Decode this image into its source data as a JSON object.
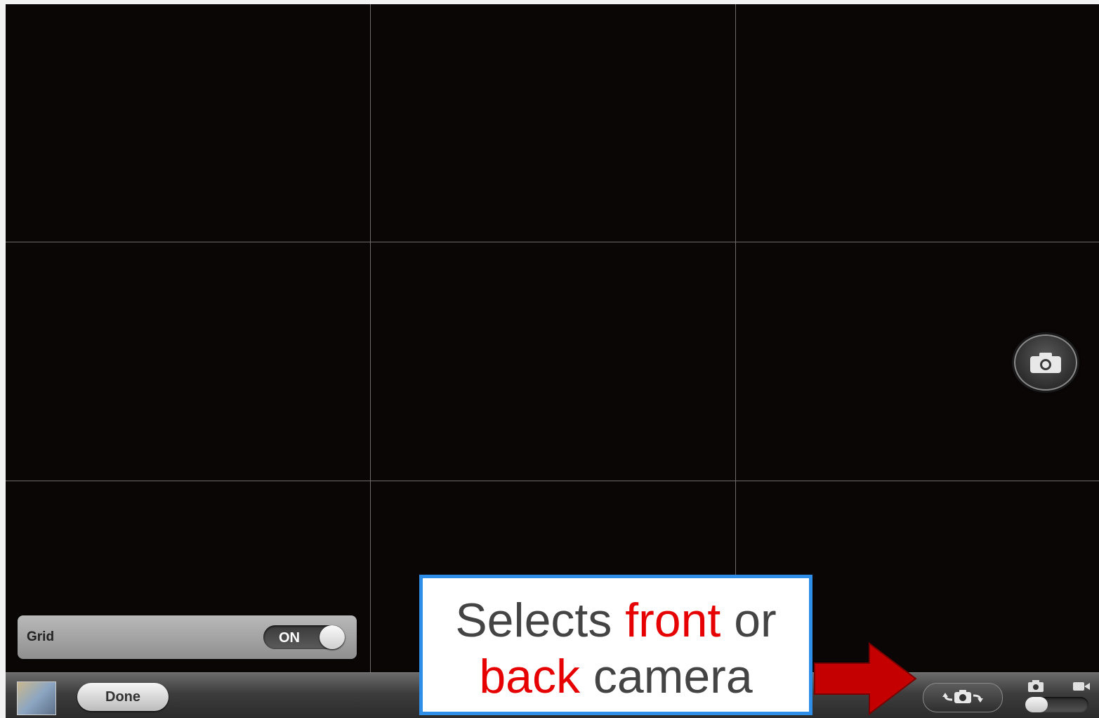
{
  "camera": {
    "grid_popover": {
      "label": "Grid",
      "toggle_state": "ON"
    },
    "toolbar": {
      "done_label": "Done"
    },
    "mode": {
      "selected": "photo"
    }
  },
  "callout": {
    "line1_part1": "Selects ",
    "line1_accent": "front",
    "line1_part2": " or",
    "line2_accent": "back",
    "line2_part2": " camera"
  },
  "colors": {
    "callout_border": "#2f8fe8",
    "callout_accent": "#e60000",
    "arrow": "#c40000"
  },
  "icons": {
    "shutter": "camera-icon",
    "switch": "switch-camera-icon",
    "photo_mode": "photo-mode-icon",
    "video_mode": "video-mode-icon",
    "thumbnail": "last-photo-thumbnail",
    "arrow": "right-arrow-icon"
  }
}
